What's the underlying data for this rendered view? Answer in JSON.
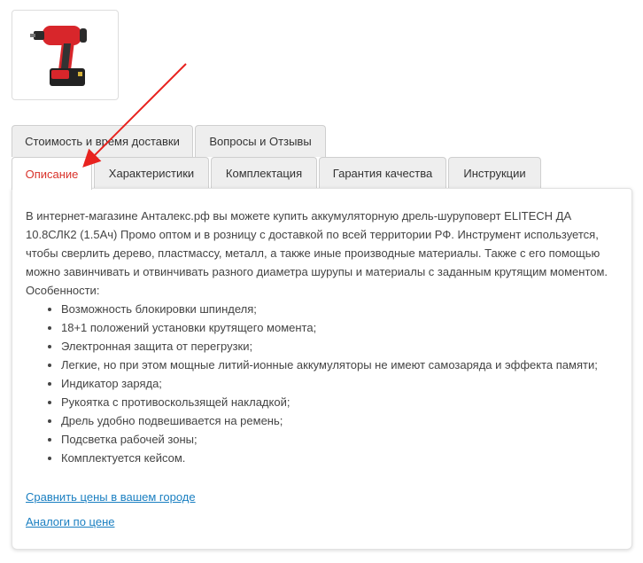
{
  "product_image": {
    "alt": "product-thumbnail"
  },
  "tabs_row1": [
    {
      "label": "Стоимость и время доставки"
    },
    {
      "label": "Вопросы и Отзывы"
    }
  ],
  "tabs_row2": [
    {
      "label": "Описание",
      "active": true
    },
    {
      "label": "Характеристики"
    },
    {
      "label": "Комплектация"
    },
    {
      "label": "Гарантия качества"
    },
    {
      "label": "Инструкции"
    }
  ],
  "description": {
    "text": "В интернет-магазине Анталекс.рф вы можете купить аккумуляторную дрель-шуруповерт ELITECH ДА 10.8СЛК2 (1.5Ач) Промо оптом и в розницу с доставкой по всей территории РФ. Инструмент используется, чтобы сверлить дерево, пластмассу, металл, а также иные производные материалы. Также с его помощью можно завинчивать и отвинчивать разного диаметра шурупы и материалы с заданным крутящим моментом.",
    "features_label": "Особенности:",
    "features": [
      "Возможность блокировки шпинделя;",
      "18+1 положений установки крутящего момента;",
      "Электронная защита от перегрузки;",
      "Легкие, но при этом мощные литий-ионные аккумуляторы не имеют самозаряда и эффекта памяти;",
      "Индикатор заряда;",
      "Рукоятка с противоскользящей накладкой;",
      "Дрель удобно подвешивается на ремень;",
      "Подсветка рабочей зоны;",
      "Комплектуется кейсом."
    ]
  },
  "links": {
    "compare_prices": "Сравнить цены в вашем городе",
    "analogs": "Аналоги по цене"
  },
  "colors": {
    "active_tab_text": "#d9332b",
    "link": "#1a7fc1",
    "annotation_arrow": "#e8231f"
  }
}
